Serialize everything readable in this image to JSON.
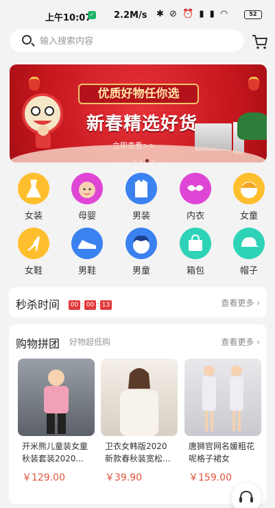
{
  "status_bar": {
    "time": "上午10:07",
    "speed": "2.2M/s",
    "battery": "52"
  },
  "search": {
    "placeholder": "输入搜索内容"
  },
  "banner": {
    "sign": "优质好物任你选",
    "headline": "新春精选好货",
    "cta": "立即查看>>",
    "slides": 4,
    "active_slide": 2
  },
  "categories": [
    {
      "label": "女装",
      "icon": "dress-icon",
      "color": "#ffbe2e"
    },
    {
      "label": "母婴",
      "icon": "baby-icon",
      "color": "#e046d6"
    },
    {
      "label": "男装",
      "icon": "shirt-icon",
      "color": "#3b82f0"
    },
    {
      "label": "内衣",
      "icon": "bra-icon",
      "color": "#e046d6"
    },
    {
      "label": "女童",
      "icon": "girl-icon",
      "color": "#ffbe2e"
    },
    {
      "label": "女鞋",
      "icon": "heel-icon",
      "color": "#ffbe2e"
    },
    {
      "label": "男鞋",
      "icon": "sneaker-icon",
      "color": "#3b82f0"
    },
    {
      "label": "男童",
      "icon": "boy-icon",
      "color": "#3b82f0"
    },
    {
      "label": "箱包",
      "icon": "bag-icon",
      "color": "#2ed3b7"
    },
    {
      "label": "帽子",
      "icon": "cap-icon",
      "color": "#2ed3b7"
    }
  ],
  "flash_sale": {
    "title": "秒杀时间",
    "hours": "00",
    "minutes": "00",
    "seconds": "13",
    "more": "查看更多"
  },
  "group_buy": {
    "title": "购物拼团",
    "subtitle": "好物超低购",
    "more": "查看更多",
    "products": [
      {
        "name": "开米熊儿童装女童秋装套装2020...",
        "price": "￥129.00"
      },
      {
        "name": "卫衣女韩版2020新款春秋装宽松...",
        "price": "￥39.90"
      },
      {
        "name": "唐狮官网名媛粗花呢格子裙女2020...",
        "price": "￥159.00"
      }
    ]
  },
  "colors": {
    "accent_red": "#e23a3a",
    "price_red": "#e0533b"
  }
}
